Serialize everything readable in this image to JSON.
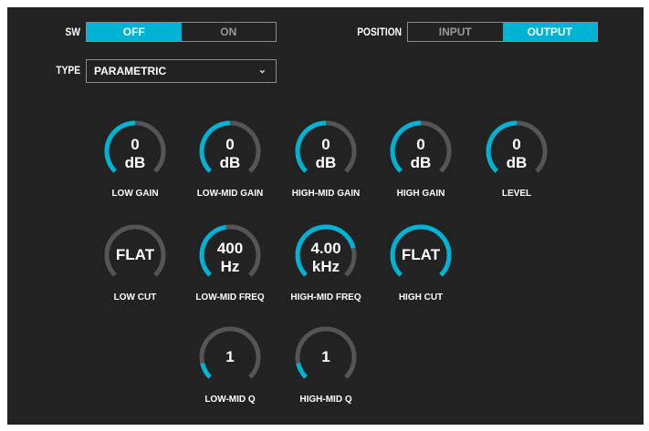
{
  "colors": {
    "accent": "#00b2d3",
    "track": "#555555",
    "background": "#222222"
  },
  "sw": {
    "label": "SW",
    "options": [
      "OFF",
      "ON"
    ],
    "selected": "OFF"
  },
  "position": {
    "label": "POSITION",
    "options": [
      "INPUT",
      "OUTPUT"
    ],
    "selected": "OUTPUT"
  },
  "type": {
    "label": "TYPE",
    "value": "PARAMETRIC"
  },
  "knobs": [
    {
      "name": "LOW GAIN",
      "value": "0",
      "unit": "dB",
      "fill": 0.5
    },
    {
      "name": "LOW-MID GAIN",
      "value": "0",
      "unit": "dB",
      "fill": 0.5
    },
    {
      "name": "HIGH-MID GAIN",
      "value": "0",
      "unit": "dB",
      "fill": 0.5
    },
    {
      "name": "HIGH GAIN",
      "value": "0",
      "unit": "dB",
      "fill": 0.5
    },
    {
      "name": "LEVEL",
      "value": "0",
      "unit": "dB",
      "fill": 0.5
    },
    {
      "name": "LOW CUT",
      "value": "FLAT",
      "unit": "",
      "fill": 0
    },
    {
      "name": "LOW-MID FREQ",
      "value": "400",
      "unit": "Hz",
      "fill": 0.47
    },
    {
      "name": "HIGH-MID FREQ",
      "value": "4.00",
      "unit": "kHz",
      "fill": 0.78
    },
    {
      "name": "HIGH CUT",
      "value": "FLAT",
      "unit": "",
      "fill": 1
    },
    {
      "name": "LOW-MID Q",
      "value": "1",
      "unit": "",
      "fill": 0.12
    },
    {
      "name": "HIGH-MID Q",
      "value": "1",
      "unit": "",
      "fill": 0.12
    }
  ]
}
